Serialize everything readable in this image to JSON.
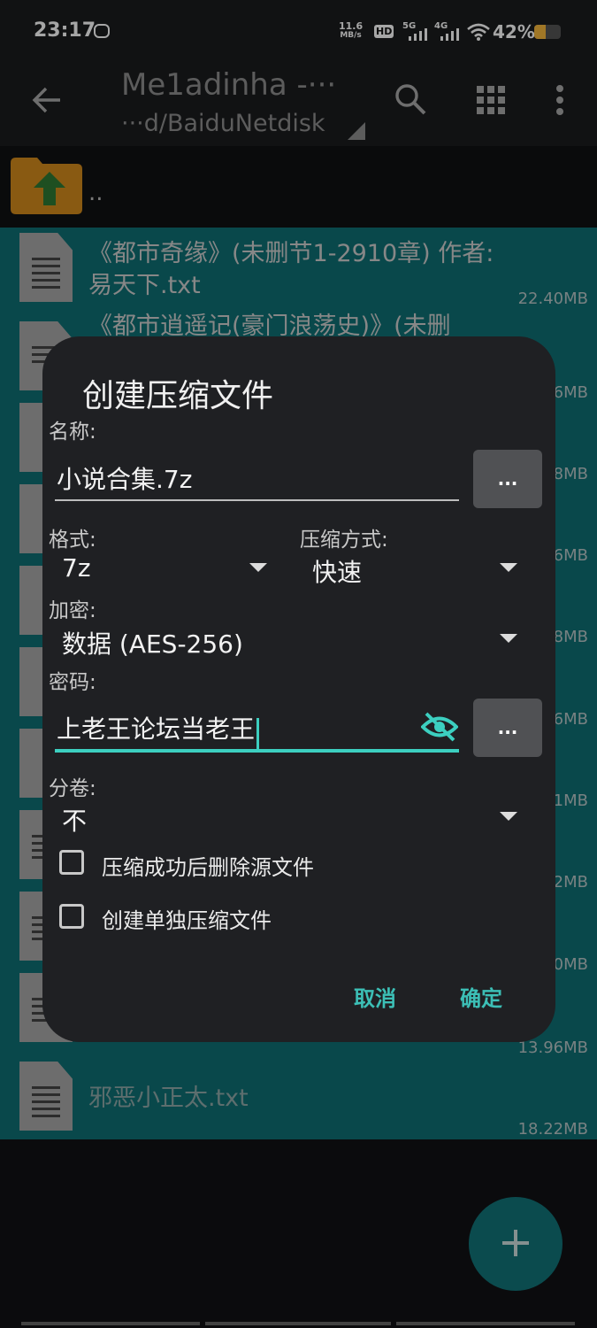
{
  "status": {
    "time": "23:17",
    "net_speed_value": "11.6",
    "net_speed_unit": "MB/s",
    "hd": "HD",
    "sig1": "5G",
    "sig2": "4G",
    "battery_text": "42%",
    "battery_level": 0.42,
    "battery_color": "#f6b73c"
  },
  "appbar": {
    "title": "Me1adinha -···",
    "subtitle": "···d/BaiduNetdisk"
  },
  "parent_label": "..",
  "files": [
    {
      "name_line1": "《都市奇缘》(未删节1-2910章) 作者:",
      "name_line2": "易天下.txt",
      "size": "22.40MB"
    },
    {
      "name_line1": "《都市逍遥记(豪门浪荡史)》(未删",
      "name_line2": "",
      "size": "6MB"
    },
    {
      "name_line1": "",
      "name_line2": "",
      "size": "8MB"
    },
    {
      "name_line1": "",
      "name_line2": "",
      "size": "6MB"
    },
    {
      "name_line1": "",
      "name_line2": "",
      "size": "8MB"
    },
    {
      "name_line1": "",
      "name_line2": "",
      "size": "6MB"
    },
    {
      "name_line1": "",
      "name_line2": "",
      "size": "1MB"
    },
    {
      "name_line1": "",
      "name_line2": "",
      "size": "2MB"
    },
    {
      "name_line1": "",
      "name_line2": "",
      "size": "0MB"
    },
    {
      "name_line1": "",
      "name_line2": "",
      "size": "13.96MB"
    },
    {
      "name_line1": "邪恶小正太.txt",
      "name_line2": "",
      "size": "18.22MB"
    }
  ],
  "dialog": {
    "title": "创建压缩文件",
    "name_label": "名称:",
    "name_value": "小说合集.7z",
    "more_label": "...",
    "format_label": "格式:",
    "format_value": "7z",
    "method_label": "压缩方式:",
    "method_value": "快速",
    "encrypt_label": "加密:",
    "encrypt_value": "数据 (AES-256)",
    "password_label": "密码:",
    "password_value": "上老王论坛当老王",
    "split_label": "分卷:",
    "split_value": "不",
    "delete_source_label": "压缩成功后删除源文件",
    "separate_label": "创建单独压缩文件",
    "cancel_label": "取消",
    "ok_label": "确定"
  },
  "colors": {
    "accent": "#3ccfc0",
    "list_highlight": "#0f6f73"
  }
}
